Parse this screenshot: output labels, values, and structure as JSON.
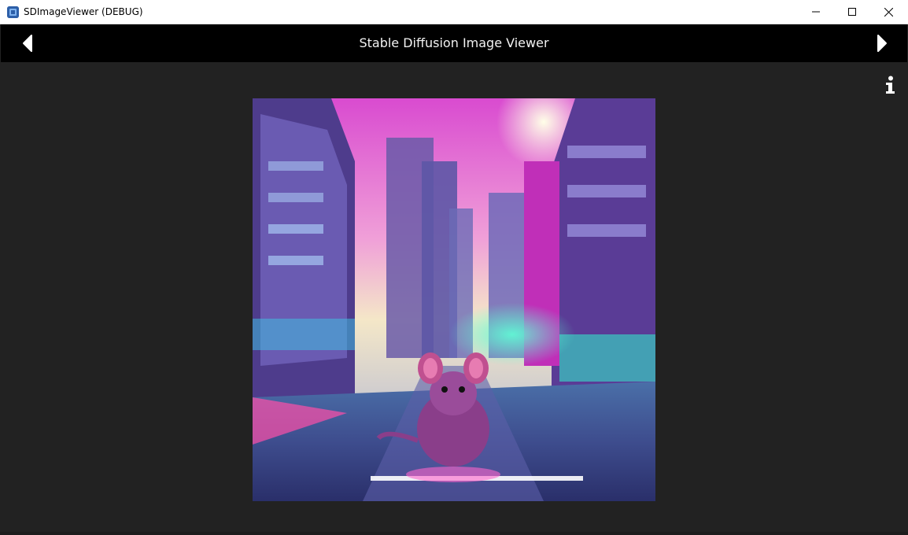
{
  "window": {
    "title": "SDImageViewer (DEBUG)",
    "icon": "app-icon",
    "controls": [
      "minimize-icon",
      "maximize-icon",
      "close-icon"
    ]
  },
  "header": {
    "title": "Stable Diffusion Image Viewer",
    "prev_icon": "chevron-left-icon",
    "next_icon": "chevron-right-icon"
  },
  "toolbar": {
    "info_icon": "info-icon"
  },
  "colors": {
    "background": "#222222",
    "header": "#000000",
    "titlebar": "#ffffff",
    "text": "#f2f2f2"
  }
}
